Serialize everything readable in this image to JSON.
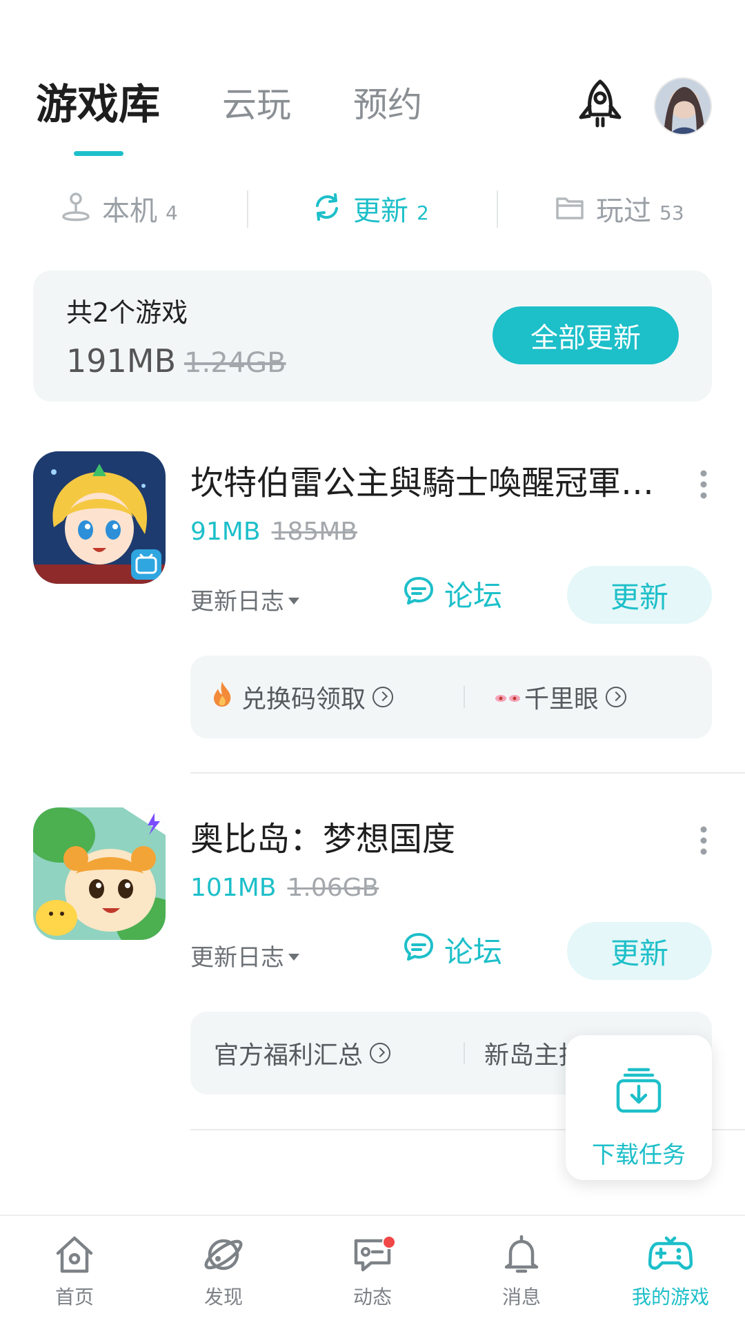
{
  "header": {
    "tabs": [
      {
        "label": "游戏库",
        "active": true
      },
      {
        "label": "云玩",
        "active": false
      },
      {
        "label": "预约",
        "active": false
      }
    ],
    "rocket_icon": "rocket-icon",
    "avatar_icon": "user-avatar"
  },
  "filters": [
    {
      "label": "本机",
      "count": "4",
      "icon": "joystick-icon",
      "active": false
    },
    {
      "label": "更新",
      "count": "2",
      "icon": "refresh-icon",
      "active": true
    },
    {
      "label": "玩过",
      "count": "53",
      "icon": "folder-icon",
      "active": false
    }
  ],
  "summary": {
    "title": "共2个游戏",
    "size": "191MB",
    "original_size": "1.24GB",
    "update_all_label": "全部更新"
  },
  "games": [
    {
      "name": "坎特伯雷公主與騎士喚醒冠軍…",
      "size_new": "91MB",
      "size_old": "185MB",
      "changelog_label": "更新日志",
      "forum_label": "论坛",
      "update_label": "更新",
      "promos": [
        {
          "label": "兑换码领取",
          "icon": "fire-icon"
        },
        {
          "label": "千里眼",
          "icon": "eyes-icon"
        }
      ]
    },
    {
      "name": "奥比岛：梦想国度",
      "size_new": "101MB",
      "size_old": "1.06GB",
      "changelog_label": "更新日志",
      "forum_label": "论坛",
      "update_label": "更新",
      "promos": [
        {
          "label": "官方福利汇总",
          "icon": ""
        },
        {
          "label": "新岛主指",
          "icon": ""
        }
      ]
    }
  ],
  "download_task": {
    "label": "下载任务",
    "icon": "download-tray-icon"
  },
  "bottom_nav": [
    {
      "label": "首页",
      "icon": "home-icon",
      "active": false
    },
    {
      "label": "发现",
      "icon": "planet-icon",
      "active": false
    },
    {
      "label": "动态",
      "icon": "chat-icon",
      "active": false,
      "badge": true
    },
    {
      "label": "消息",
      "icon": "bell-icon",
      "active": false
    },
    {
      "label": "我的游戏",
      "icon": "gamepad-icon",
      "active": true
    }
  ],
  "colors": {
    "accent": "#1dbfc9",
    "badge": "#f04747",
    "card_bg": "#f3f6f7"
  }
}
